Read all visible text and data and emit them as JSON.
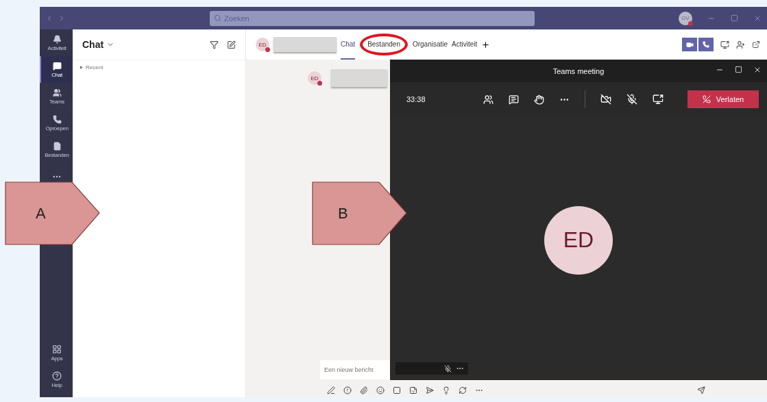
{
  "title_bar": {
    "search_placeholder": "Zoeken",
    "user_avatar": "GV"
  },
  "rail": {
    "items": [
      {
        "label": "Activiteit",
        "kind": "bell",
        "selected": false
      },
      {
        "label": "Chat",
        "kind": "chat",
        "selected": true
      },
      {
        "label": "Teams",
        "kind": "teams",
        "selected": false
      },
      {
        "label": "Oproepen",
        "kind": "phone",
        "selected": false
      },
      {
        "label": "Bestanden",
        "kind": "file",
        "selected": false
      }
    ],
    "bottom_items": [
      {
        "label": "Apps",
        "kind": "apps"
      },
      {
        "label": "Help",
        "kind": "help"
      }
    ]
  },
  "chat_list": {
    "title": "Chat",
    "sections": [
      {
        "label": "Recent",
        "expanded": false
      }
    ]
  },
  "conversation": {
    "avatar": "ED",
    "tabs": [
      {
        "label": "Chat",
        "selected": true
      },
      {
        "label": "Bestanden",
        "selected": false,
        "highlighted": true
      },
      {
        "label": "Organisatie",
        "selected": false
      },
      {
        "label": "Activiteit",
        "selected": false
      }
    ],
    "message": {
      "avatar": "ED"
    },
    "compose_placeholder": "Een nieuw bericht"
  },
  "meeting": {
    "title": "Teams meeting",
    "timer": "33:38",
    "video_on": false,
    "mic_on": false,
    "leave_label": "Verlaten",
    "participant": "ED",
    "tile_mic_on": false
  },
  "callouts": [
    {
      "label": "A"
    },
    {
      "label": "B"
    }
  ]
}
